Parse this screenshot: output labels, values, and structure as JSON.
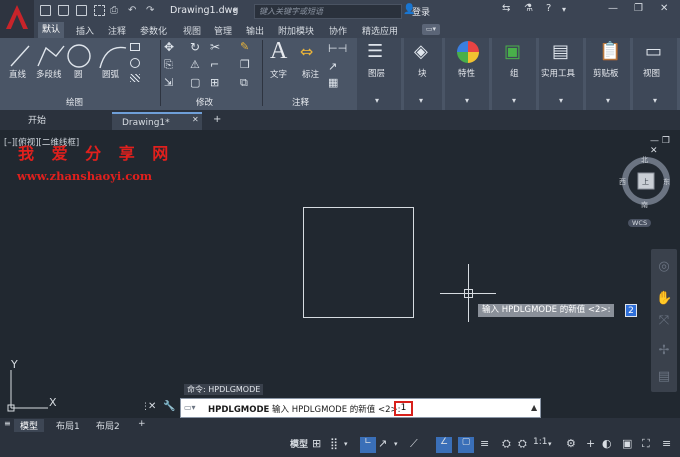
{
  "app": {
    "document_title": "Drawing1.dwg",
    "search_placeholder": "键入关键字或短语",
    "login_label": "登录"
  },
  "ribbon_tabs": [
    "默认",
    "插入",
    "注释",
    "参数化",
    "视图",
    "管理",
    "输出",
    "附加模块",
    "协作",
    "精选应用"
  ],
  "ribbon": {
    "draw": {
      "line": "直线",
      "polyline": "多段线",
      "circle": "圆",
      "arc": "圆弧",
      "panel_title": "绘图"
    },
    "modify": {
      "panel_title": "修改"
    },
    "annotation": {
      "text": "文字",
      "dimension": "标注",
      "panel_title": "注释"
    },
    "big": {
      "layers": "图层",
      "block": "块",
      "properties": "特性",
      "groups": "组",
      "utilities": "实用工具",
      "clipboard": "剪贴板",
      "view": "视图"
    }
  },
  "doc_tabs": {
    "start": "开始",
    "drawing": "Drawing1*"
  },
  "viewport": {
    "label": "[–][俯视][二维线框]",
    "watermark_cn": "我 爱 分 享 网",
    "watermark_url": "www.zhanshaoyi.com"
  },
  "viewcube": {
    "north": "北",
    "south": "南",
    "east": "东",
    "west": "西",
    "wcs": "WCS",
    "top": "上"
  },
  "ucs": {
    "x": "X",
    "y": "Y"
  },
  "prompt": {
    "text": "输入 HPDLGMODE 的新值 <2>:",
    "value": "2"
  },
  "command": {
    "history": "命令: HPDLGMODE",
    "line_cmd": "HPDLGMODE",
    "line_text": "输入 HPDLGMODE 的新值 <2>:",
    "input_value": "1"
  },
  "layout_tabs": [
    "模型",
    "布局1",
    "布局2"
  ],
  "statusbar": {
    "model": "模型",
    "scale": "1:1"
  }
}
